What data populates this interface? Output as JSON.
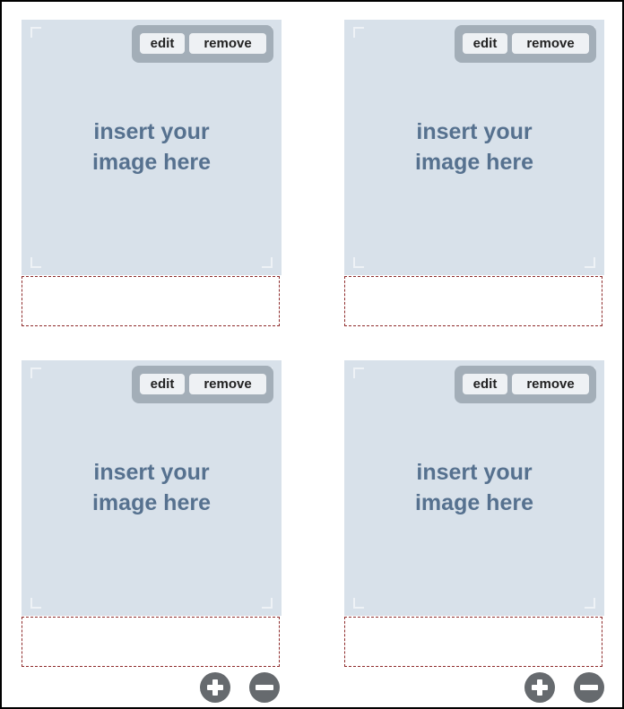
{
  "slots": [
    {
      "edit_label": "edit",
      "remove_label": "remove",
      "placeholder_line1": "insert your",
      "placeholder_line2": "image here",
      "caption": ""
    },
    {
      "edit_label": "edit",
      "remove_label": "remove",
      "placeholder_line1": "insert your",
      "placeholder_line2": "image here",
      "caption": ""
    },
    {
      "edit_label": "edit",
      "remove_label": "remove",
      "placeholder_line1": "insert your",
      "placeholder_line2": "image here",
      "caption": ""
    },
    {
      "edit_label": "edit",
      "remove_label": "remove",
      "placeholder_line1": "insert your",
      "placeholder_line2": "image here",
      "caption": ""
    }
  ],
  "controls": {
    "add_icon": "plus-circle-icon",
    "remove_icon": "minus-circle-icon"
  }
}
